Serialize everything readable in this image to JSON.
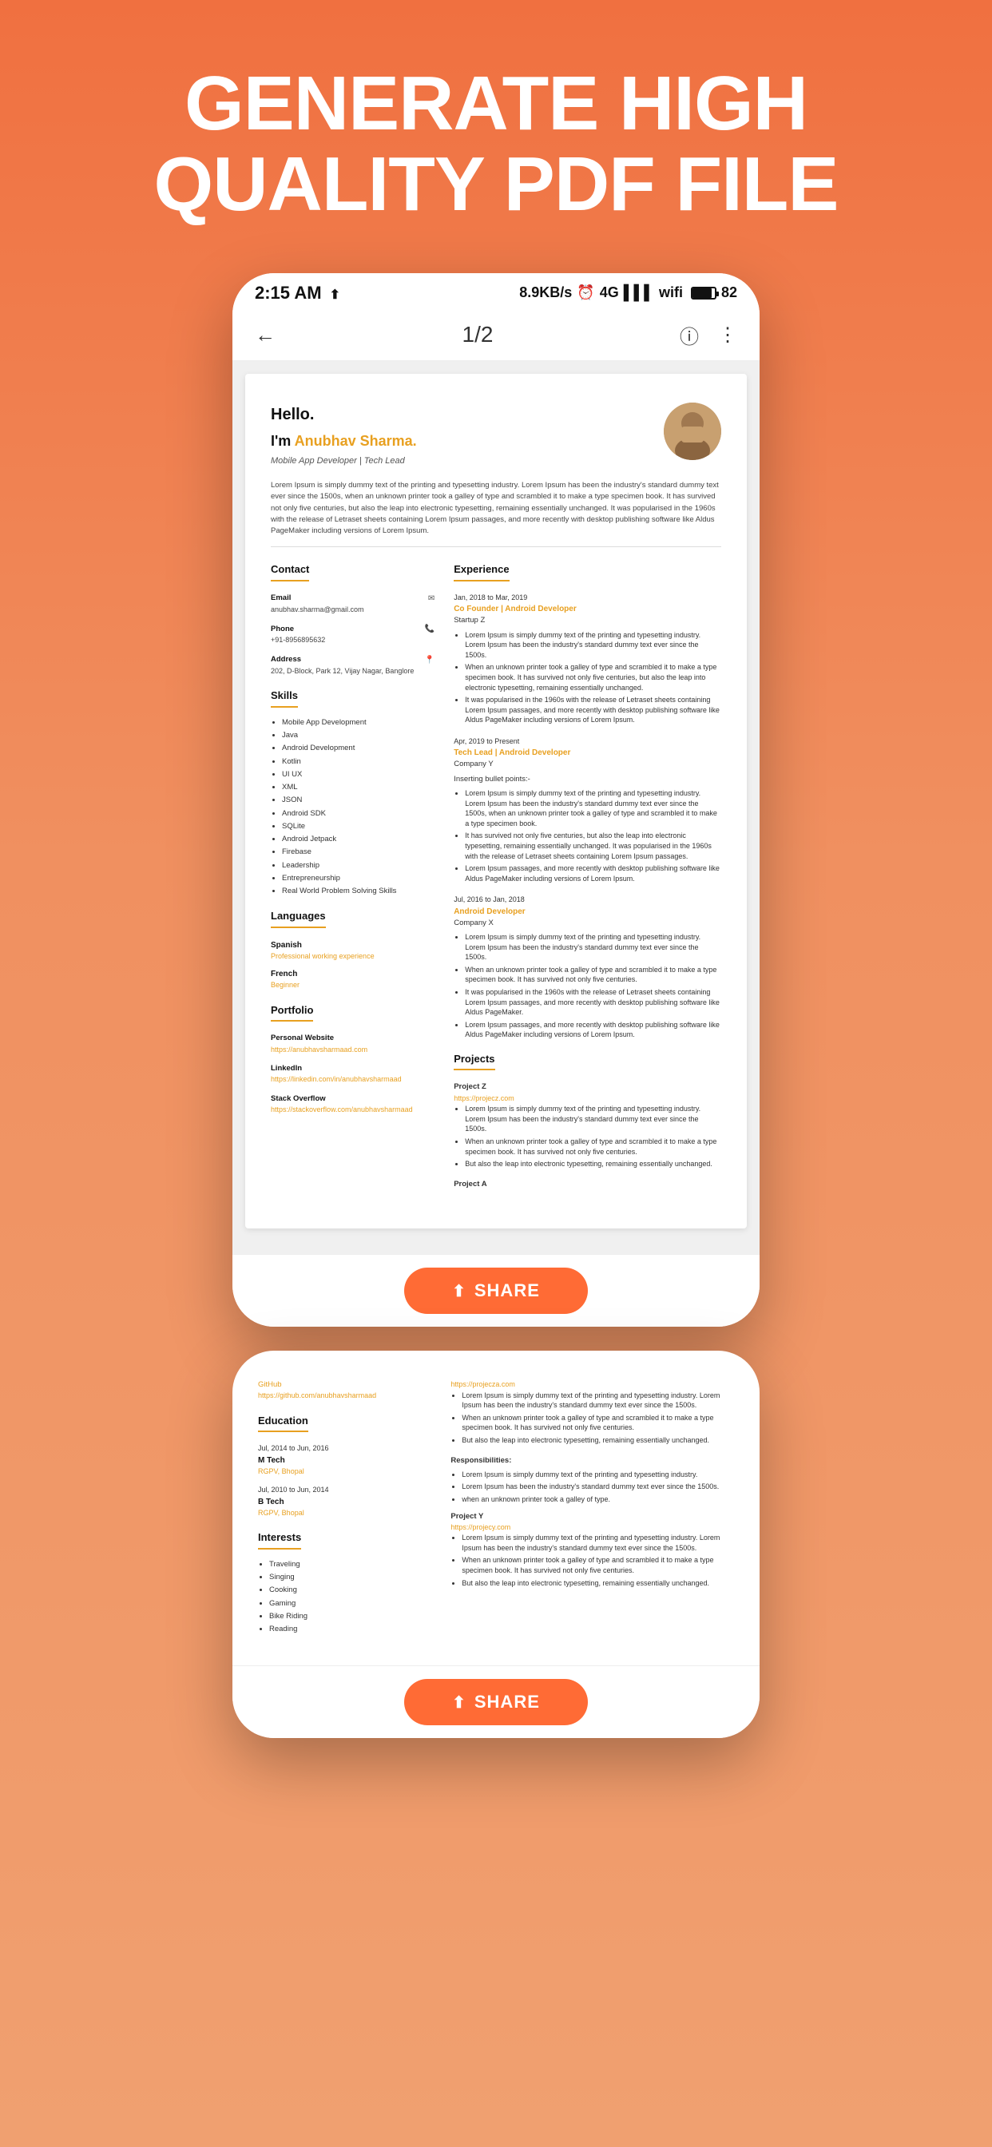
{
  "hero": {
    "title": "GENERATE HIGH QUALITY PDF FILE"
  },
  "status_bar": {
    "time": "2:15 AM",
    "upload_icon": "↑",
    "speed": "8.9KB/s",
    "network": "4G",
    "battery": "82"
  },
  "nav": {
    "back": "←",
    "page": "1/2",
    "info_icon": "ⓘ",
    "more_icon": "⋮"
  },
  "resume": {
    "greeting": "Hello.",
    "name_prefix": "I'm ",
    "name": "Anubhav Sharma.",
    "subtitle": "Mobile App Developer | Tech Lead",
    "summary": "Lorem Ipsum is simply dummy text of the printing and typesetting industry. Lorem Ipsum has been the industry's standard dummy text ever since the 1500s, when an unknown printer took a galley of type and scrambled it to make a type specimen book. It has survived not only five centuries, but also the leap into electronic typesetting, remaining essentially unchanged. It was popularised in the 1960s with the release of Letraset sheets containing Lorem Ipsum passages, and more recently with desktop publishing software like Aldus PageMaker including versions of Lorem Ipsum.",
    "contact": {
      "section_title": "Contact",
      "email_label": "Email",
      "email": "anubhav.sharma@gmail.com",
      "phone_label": "Phone",
      "phone": "+91-8956895632",
      "address_label": "Address",
      "address": "202, D-Block, Park 12, Vijay Nagar, Banglore"
    },
    "skills": {
      "section_title": "Skills",
      "items": [
        "Mobile App Development",
        "Java",
        "Android Development",
        "Kotlin",
        "UI UX",
        "XML",
        "JSON",
        "Android SDK",
        "SQLite",
        "Android Jetpack",
        "Firebase",
        "Leadership",
        "Entrepreneurship",
        "Real World Problem Solving Skills"
      ]
    },
    "languages": {
      "section_title": "Languages",
      "items": [
        {
          "name": "Spanish",
          "level": "Professional working experience"
        },
        {
          "name": "French",
          "level": "Beginner"
        }
      ]
    },
    "portfolio": {
      "section_title": "Portfolio",
      "items": [
        {
          "label": "Personal Website",
          "link": "https://anubhavsharmaad.com"
        },
        {
          "label": "LinkedIn",
          "link": "https://linkedin.com/in/anubhavsharmaad"
        },
        {
          "label": "Stack Overflow",
          "link": "https://stackoverflow.com/anubhavsharmaad"
        }
      ]
    },
    "experience": {
      "section_title": "Experience",
      "items": [
        {
          "date": "Jan, 2018 to Mar, 2019",
          "role": "Co Founder | Android Developer",
          "company": "Startup Z",
          "bullets": [
            "Lorem Ipsum is simply dummy text of the printing and typesetting industry. Lorem Ipsum has been the industry's standard dummy text ever since the 1500s.",
            "When an unknown printer took a galley of type and scrambled it to make a type specimen book. It has survived not only five centuries, but also the leap into electronic typesetting, remaining essentially unchanged.",
            "It was popularised in the 1960s with the release of Letraset sheets containing Lorem Ipsum passages, and more recently with desktop publishing software like Aldus PageMaker including versions of Lorem Ipsum."
          ]
        },
        {
          "date": "Apr, 2019 to Present",
          "role": "Tech Lead | Android Developer",
          "company": "Company Y",
          "note": "Inserting bullet points:-",
          "bullets": [
            "Lorem Ipsum is simply dummy text of the printing and typesetting industry. Lorem Ipsum has been the industry's standard dummy text ever since the 1500s, when an unknown printer took a galley of type and scrambled it to make a type specimen book.",
            "It has survived not only five centuries, but also the leap into electronic typesetting, remaining essentially unchanged. It was popularised in the 1960s with the release of Letraset sheets containing Lorem Ipsum passages.",
            "Lorem Ipsum passages, and more recently with desktop publishing software like Aldus PageMaker including versions of Lorem Ipsum."
          ]
        },
        {
          "date": "Jul, 2016 to Jan, 2018",
          "role": "Android Developer",
          "company": "Company X",
          "bullets": [
            "Lorem Ipsum is simply dummy text of the printing and typesetting industry. Lorem Ipsum has been the industry's standard dummy text ever since the 1500s.",
            "When an unknown printer took a galley of type and scrambled it to make a type specimen book. It has survived not only five centuries.",
            "It was popularised in the 1960s with the release of Letraset sheets containing Lorem Ipsum passages, and more recently with desktop publishing software like Aldus PageMaker.",
            "Lorem Ipsum passages, and more recently with desktop publishing software like Aldus PageMaker including versions of Lorem Ipsum."
          ]
        }
      ]
    },
    "projects": {
      "section_title": "Projects",
      "items": [
        {
          "name": "Project Z",
          "link": "https://projecz.com",
          "bullets": [
            "Lorem Ipsum is simply dummy text of the printing and typesetting industry. Lorem Ipsum has been the industry's standard dummy text ever since the 1500s.",
            "When an unknown printer took a galley of type and scrambled it to make a type specimen book. It has survived not only five centuries.",
            "But also the leap into electronic typesetting, remaining essentially unchanged."
          ]
        },
        {
          "name": "Project A",
          "link": "",
          "bullets": []
        }
      ]
    }
  },
  "page2": {
    "github": {
      "label": "GitHub",
      "link": "https://github.com/anubhavsharmaad",
      "link2": "https://projecza.com"
    },
    "education": {
      "section_title": "Education",
      "items": [
        {
          "date": "Jul, 2014 to Jun, 2016",
          "degree": "M Tech",
          "school": "RGPV, Bhopal"
        },
        {
          "date": "Jul, 2010 to Jun, 2014",
          "degree": "B Tech",
          "school": "RGPV, Bhopal"
        }
      ]
    },
    "interests": {
      "section_title": "Interests",
      "items": [
        "Traveling",
        "Singing",
        "Cooking",
        "Gaming",
        "Bike Riding",
        "Reading"
      ]
    },
    "projects_continued": {
      "project_a": {
        "link": "https://projecza.com",
        "bullets": [
          "Lorem Ipsum is simply dummy text of the printing and typesetting industry. Lorem Ipsum has been the industry's standard dummy text ever since the 1500s.",
          "When an unknown printer took a galley of type and scrambled it to make a type specimen book. It has survived not only five centuries.",
          "But also the leap into electronic typesetting, remaining essentially unchanged."
        ]
      },
      "responsibilities_label": "Responsibilities:",
      "responsibilities": [
        "Lorem Ipsum is simply dummy text of the printing and typesetting industry.",
        "Lorem Ipsum has been the industry's standard dummy text ever since the 1500s.",
        "when an unknown printer took a galley of type."
      ],
      "project_y": {
        "name": "Project Y",
        "link": "https://projecy.com",
        "bullets": [
          "Lorem Ipsum is simply dummy text of the printing and typesetting industry. Lorem Ipsum has been the industry's standard dummy text ever since the 1500s.",
          "When an unknown printer took a galley of type and scrambled it to make a type specimen book. It has survived not only five centuries.",
          "But also the leap into electronic typesetting, remaining essentially unchanged."
        ]
      }
    },
    "share_button": "SHARE",
    "partial_text": [
      "setting industry. Lorem",
      "nce the 1500s.",
      "led it to make a"
    ]
  }
}
